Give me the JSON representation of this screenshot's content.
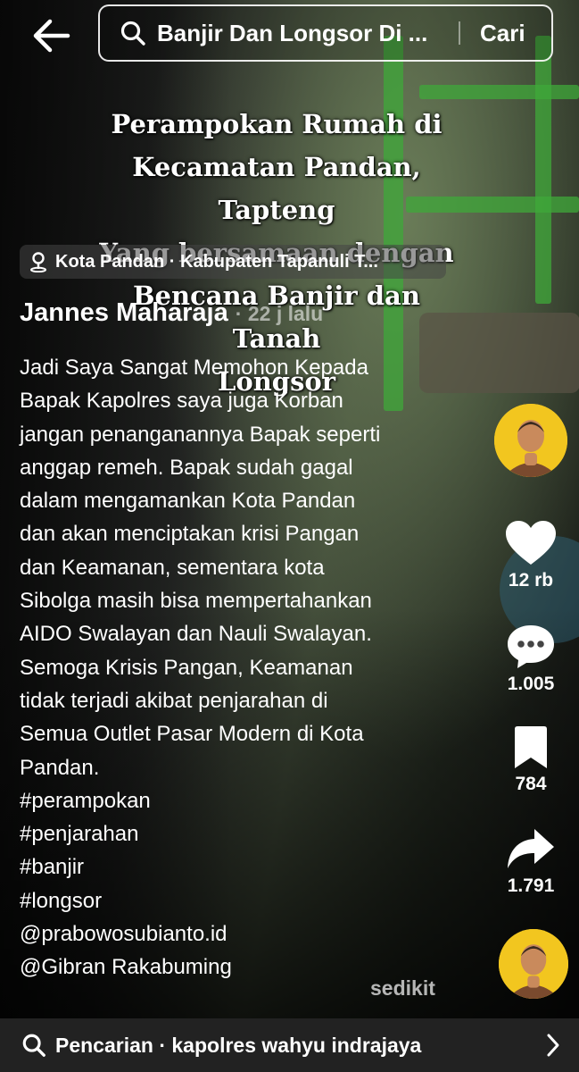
{
  "top_bar": {
    "search_query": "Banjir Dan Longsor Di ...",
    "search_button_label": "Cari"
  },
  "video": {
    "overlay_title_lines": [
      "Perampokan  Rumah di",
      "Kecamatan Pandan, Tapteng",
      "Yang bersamaan dengan",
      "Bencana Banjir dan Tanah",
      "Longsor"
    ]
  },
  "location": {
    "label": "Kota Pandan · Kabupaten Tapanuli T..."
  },
  "post": {
    "author": "Jannes Maharaja",
    "time_ago": "· 22 j lalu",
    "caption_lines": [
      "Jadi Saya Sangat Memohon Kepada",
      "Bapak Kapolres saya juga Korban",
      "jangan penanganannya Bapak seperti",
      "anggap remeh. Bapak sudah gagal",
      "dalam mengamankan Kota Pandan",
      "dan akan menciptakan krisi Pangan",
      "dan Keamanan, sementara kota",
      "Sibolga masih bisa mempertahankan",
      "AIDO Swalayan dan Nauli Swalayan.",
      "Semoga Krisis Pangan, Keamanan",
      "tidak terjadi akibat penjarahan di",
      "Semua Outlet Pasar Modern di Kota",
      "Pandan."
    ],
    "hashtags": [
      "#perampokan",
      "#penjarahan",
      "#banjir",
      "#longsor"
    ],
    "mentions": [
      "@prabowosubianto.id",
      "@Gibran Rakabuming"
    ],
    "more_label": "sedikit"
  },
  "actions": {
    "likes": "12 rb",
    "comments": "1.005",
    "bookmarks": "784",
    "shares": "1.791"
  },
  "bottom_bar": {
    "label": "Pencarian · kapolres wahyu indrajaya"
  },
  "colors": {
    "avatar_bg": "#f2c61f",
    "shelf_green": "#3fa83a"
  }
}
